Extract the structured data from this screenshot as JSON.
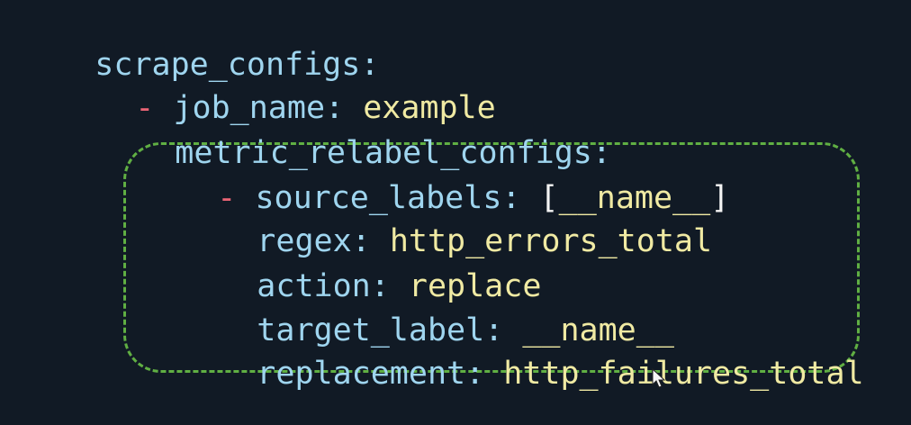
{
  "code": {
    "line1": {
      "key": "scrape_configs",
      "colon": ":"
    },
    "line2": {
      "dash": "-",
      "key": "job_name",
      "colon": ":",
      "value": "example"
    },
    "line3": {
      "key": "metric_relabel_configs",
      "colon": ":"
    },
    "line4": {
      "dash": "-",
      "key": "source_labels",
      "colon": ":",
      "open_bracket": "[",
      "value": "__name__",
      "close_bracket": "]"
    },
    "line5": {
      "key": "regex",
      "colon": ":",
      "value": "http_errors_total"
    },
    "line6": {
      "key": "action",
      "colon": ":",
      "value": "replace"
    },
    "line7": {
      "key": "target_label",
      "colon": ":",
      "value": "__name__"
    },
    "line8": {
      "key": "replacement",
      "colon": ":",
      "value": "http_failures_total"
    }
  },
  "colors": {
    "background": "#111a25",
    "key": "#9fd5ef",
    "dash": "#ea6475",
    "value": "#f0eaa3",
    "highlight": "#65b845"
  },
  "icons": {
    "cursor": "mouse-pointer-icon"
  }
}
